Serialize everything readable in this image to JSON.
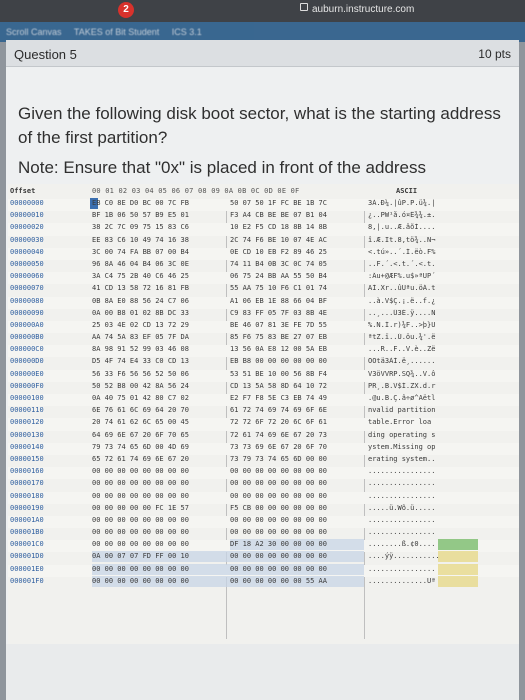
{
  "browser": {
    "url": "auburn.instructure.com",
    "notification_count": "2"
  },
  "nav_blurred": [
    "Scroll Canvas",
    "TAKES of Bit Student",
    "ICS 3.1"
  ],
  "question": {
    "title": "Question 5",
    "points": "10 pts",
    "text": "Given the following disk boot sector, what is the starting address of the first partition?",
    "note": "Note: Ensure that \"0x\" is placed in front of the address"
  },
  "hex_view": {
    "header_offset": "Offset",
    "header_bytes": "00 01 02 03 04 05 06 07   08 09 0A 0B 0C 0D 0E 0F",
    "header_ascii": "ASCII",
    "rows": [
      {
        "off": "00000000",
        "h1": "EB C0 8E D0 BC 00 7C FB",
        "h2": "50 07 50 1F FC BE 1B 7C",
        "asc": "3À.Ð¼.|ûP.P.ü¾.|"
      },
      {
        "off": "00000010",
        "h1": "BF 1B 06 50 57 B9 E5 01",
        "h2": "F3 A4 CB BE BE 07 B1 04",
        "asc": "¿..PW¹å.ó¤Ë¾¾.±."
      },
      {
        "off": "00000020",
        "h1": "38 2C 7C 09 75 15 83 C6",
        "h2": "10 E2 F5 CD 18 8B 14 8B",
        "asc": "8,|.u..Æ.âõÍ...."
      },
      {
        "off": "00000030",
        "h1": "EE 83 C6 10 49 74 16 38",
        "h2": "2C 74 F6 BE 10 07 4E AC",
        "asc": "î.Æ.It.8,tö¾..N¬"
      },
      {
        "off": "00000040",
        "h1": "3C 00 74 FA BB 07 00 B4",
        "h2": "0E CD 10 EB F2 89 46 25",
        "asc": "<.tú»..´.Í.ëò.F%"
      },
      {
        "off": "00000050",
        "h1": "96 8A 46 04 B4 06 3C 0E",
        "h2": "74 11 B4 0B 3C 0C 74 05",
        "asc": "..F.´.<.t.´.<.t."
      },
      {
        "off": "00000060",
        "h1": "3A C4 75 2B 40 C6 46 25",
        "h2": "06 75 24 BB AA 55 50 B4",
        "asc": ":Äu+@ÆF%.u$»ªUP´"
      },
      {
        "off": "00000070",
        "h1": "41 CD 13 58 72 16 81 FB",
        "h2": "55 AA 75 10 F6 C1 01 74",
        "asc": "AÍ.Xr..ûUªu.öÁ.t"
      },
      {
        "off": "00000080",
        "h1": "0B 8A E0 88 56 24 C7 06",
        "h2": "A1 06 EB 1E 88 66 04 BF",
        "asc": "..à.V$Ç.¡.ë..f.¿"
      },
      {
        "off": "00000090",
        "h1": "0A 00 B8 01 02 8B DC 33",
        "h2": "C9 83 FF 05 7F 03 8B 4E",
        "asc": "..¸...Ü3É.ÿ....N"
      },
      {
        "off": "000000A0",
        "h1": "25 03 4E 02 CD 13 72 29",
        "h2": "BE 46 07 81 3E FE 7D 55",
        "asc": "%.N.Í.r)¾F..>þ}U"
      },
      {
        "off": "000000B0",
        "h1": "AA 74 5A 83 EF 05 7F DA",
        "h2": "85 F6 75 83 BE 27 07 EB",
        "asc": "ªtZ.ï..Ú.öu.¾'.ë"
      },
      {
        "off": "000000C0",
        "h1": "8A 98 91 52 99 03 46 08",
        "h2": "13 56 0A E8 12 00 5A EB",
        "asc": "...R..F..V.è..Zë"
      },
      {
        "off": "000000D0",
        "h1": "D5 4F 74 E4 33 C0 CD 13",
        "h2": "EB B8 00 00 00 00 00 00",
        "asc": "ÕOtä3ÀÍ.ë¸......"
      },
      {
        "off": "000000E0",
        "h1": "56 33 F6 56 56 52 50 06",
        "h2": "53 51 BE 10 00 56 8B F4",
        "asc": "V3öVVRP.SQ¾..V.ô"
      },
      {
        "off": "000000F0",
        "h1": "50 52 B8 00 42 8A 56 24",
        "h2": "CD 13 5A 58 8D 64 10 72",
        "asc": "PR¸.B.V$Í.ZX.d.r"
      },
      {
        "off": "00000100",
        "h1": "0A 40 75 01 42 80 C7 02",
        "h2": "E2 F7 F8 5E C3 EB 74 49",
        "asc": ".@u.B.Ç.â÷ø^Ãëtl"
      },
      {
        "off": "00000110",
        "h1": "6E 76 61 6C 69 64 20 70",
        "h2": "61 72 74 69 74 69 6F 6E",
        "asc": "nvalid partition"
      },
      {
        "off": "00000120",
        "h1": "20 74 61 62 6C 65 00 45",
        "h2": "72 72 6F 72 20 6C 6F 61",
        "asc": " table.Error loa"
      },
      {
        "off": "00000130",
        "h1": "64 69 6E 67 20 6F 70 65",
        "h2": "72 61 74 69 6E 67 20 73",
        "asc": "ding operating s"
      },
      {
        "off": "00000140",
        "h1": "79 73 74 65 6D 00 4D 69",
        "h2": "73 73 69 6E 67 20 6F 70",
        "asc": "ystem.Missing op"
      },
      {
        "off": "00000150",
        "h1": "65 72 61 74 69 6E 67 20",
        "h2": "73 79 73 74 65 6D 00 00",
        "asc": "erating system.."
      },
      {
        "off": "00000160",
        "h1": "00 00 00 00 00 00 00 00",
        "h2": "00 00 00 00 00 00 00 00",
        "asc": "................"
      },
      {
        "off": "00000170",
        "h1": "00 00 00 00 00 00 00 00",
        "h2": "00 00 00 00 00 00 00 00",
        "asc": "................"
      },
      {
        "off": "00000180",
        "h1": "00 00 00 00 00 00 00 00",
        "h2": "00 00 00 00 00 00 00 00",
        "asc": "................"
      },
      {
        "off": "00000190",
        "h1": "00 00 00 00 00 FC 1E 57",
        "h2": "F5 CB 00 00 00 00 00 00",
        "asc": ".....ü.Wõ.ü....."
      },
      {
        "off": "000001A0",
        "h1": "00 00 00 00 00 00 00 00",
        "h2": "00 00 00 00 00 00 00 00",
        "asc": "................"
      },
      {
        "off": "000001B0",
        "h1": "00 00 00 00 00 00 00 00",
        "h2": "00 00 00 00 00 00 00 00",
        "asc": "................"
      },
      {
        "off": "000001C0",
        "h1": "00 00 00 00 00 00 00 00",
        "h2": "DF 18 A2 30 00 00 00 00",
        "asc": "........ß.¢0...."
      },
      {
        "off": "000001D0",
        "h1": "0A 00 07 07 FD FF 00 10",
        "h2": "00 00 00 00 00 00 00 00",
        "asc": "....ýÿ..........."
      },
      {
        "off": "000001E0",
        "h1": "00 00 00 00 00 00 00 00",
        "h2": "00 00 00 00 00 00 00 00",
        "asc": "................"
      },
      {
        "off": "000001F0",
        "h1": "00 00 00 00 00 00 00 00",
        "h2": "00 00 00 00 00 00 55 AA",
        "asc": "..............Uª"
      }
    ]
  }
}
